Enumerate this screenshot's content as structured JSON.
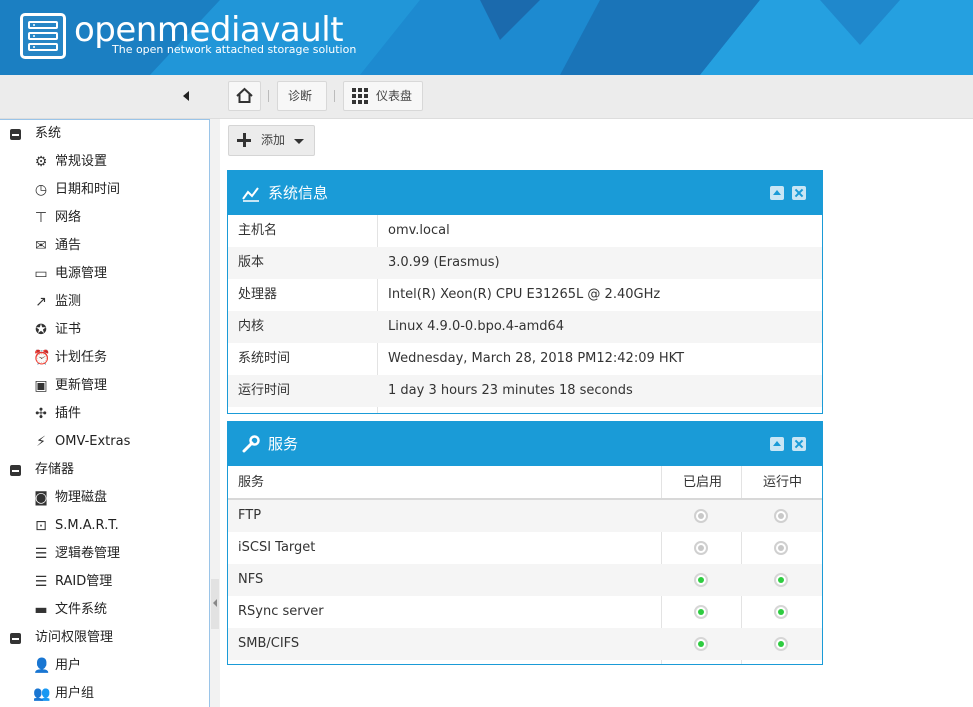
{
  "header": {
    "brand": "openmediavault",
    "tagline": "The open network attached storage solution"
  },
  "breadcrumb": {
    "home_icon": "home-icon",
    "items": [
      "诊断",
      "仪表盘"
    ]
  },
  "toolbar": {
    "add_label": "添加"
  },
  "sidebar": {
    "groups": [
      {
        "label": "系统",
        "items": [
          {
            "label": "常规设置",
            "icon": "gears-icon"
          },
          {
            "label": "日期和时间",
            "icon": "clock-icon"
          },
          {
            "label": "网络",
            "icon": "network-icon"
          },
          {
            "label": "通告",
            "icon": "envelope-icon"
          },
          {
            "label": "电源管理",
            "icon": "battery-icon"
          },
          {
            "label": "监测",
            "icon": "line-chart-icon"
          },
          {
            "label": "证书",
            "icon": "certificate-icon"
          },
          {
            "label": "计划任务",
            "icon": "alarm-clock-icon"
          },
          {
            "label": "更新管理",
            "icon": "update-icon"
          },
          {
            "label": "插件",
            "icon": "puzzle-icon"
          },
          {
            "label": "OMV-Extras",
            "icon": "plug-icon"
          }
        ]
      },
      {
        "label": "存储器",
        "items": [
          {
            "label": "物理磁盘",
            "icon": "hdd-icon"
          },
          {
            "label": "S.M.A.R.T.",
            "icon": "smart-monitor-icon"
          },
          {
            "label": "逻辑卷管理",
            "icon": "database-icon"
          },
          {
            "label": "RAID管理",
            "icon": "raid-icon"
          },
          {
            "label": "文件系统",
            "icon": "folder-icon"
          }
        ]
      },
      {
        "label": "访问权限管理",
        "items": [
          {
            "label": "用户",
            "icon": "user-icon"
          },
          {
            "label": "用户组",
            "icon": "users-icon"
          }
        ]
      }
    ]
  },
  "sysinfo": {
    "title": "系统信息",
    "rows": [
      {
        "key": "主机名",
        "value": "omv.local"
      },
      {
        "key": "版本",
        "value": "3.0.99 (Erasmus)"
      },
      {
        "key": "处理器",
        "value": "Intel(R) Xeon(R) CPU E31265L @ 2.40GHz"
      },
      {
        "key": "内核",
        "value": "Linux 4.9.0-0.bpo.4-amd64"
      },
      {
        "key": "系统时间",
        "value": "Wednesday, March 28, 2018 PM12:42:09 HKT"
      },
      {
        "key": "运行时间",
        "value": "1 day 3 hours 23 minutes 18 seconds"
      }
    ]
  },
  "services": {
    "title": "服务",
    "columns": [
      "服务",
      "已启用",
      "运行中"
    ],
    "rows": [
      {
        "name": "FTP",
        "enabled": false,
        "running": false
      },
      {
        "name": "iSCSI Target",
        "enabled": false,
        "running": false
      },
      {
        "name": "NFS",
        "enabled": true,
        "running": true
      },
      {
        "name": "RSync server",
        "enabled": true,
        "running": true
      },
      {
        "name": "SMB/CIFS",
        "enabled": true,
        "running": true
      }
    ]
  },
  "colors": {
    "accent": "#1a9bd7",
    "header": "#1a8fd3",
    "status_on": "#2ecc40",
    "status_off": "#c8c8c8"
  }
}
